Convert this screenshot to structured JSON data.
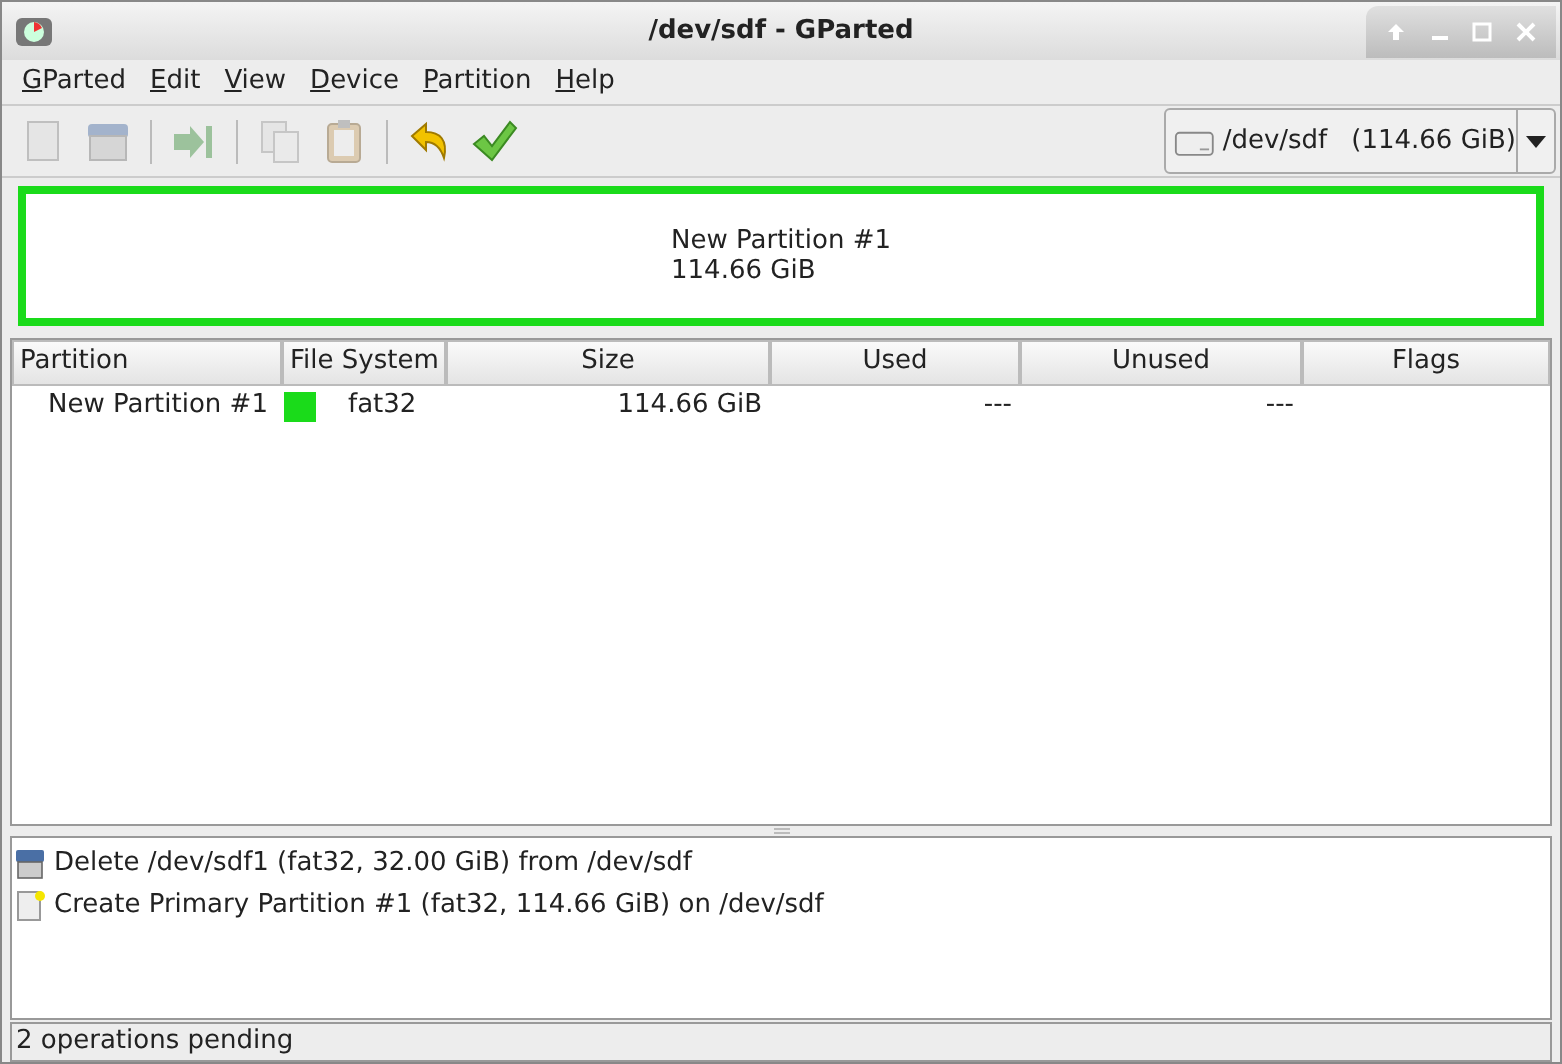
{
  "window": {
    "title": "/dev/sdf - GParted"
  },
  "menu": [
    "GParted",
    "Edit",
    "View",
    "Device",
    "Partition",
    "Help"
  ],
  "toolbar": [
    {
      "kind": "new",
      "disabled": true
    },
    {
      "kind": "delete",
      "disabled": true
    },
    {
      "kind": "sep"
    },
    {
      "kind": "resize",
      "disabled": true
    },
    {
      "kind": "sep"
    },
    {
      "kind": "copy",
      "disabled": true
    },
    {
      "kind": "paste",
      "disabled": true
    },
    {
      "kind": "sep"
    },
    {
      "kind": "undo",
      "disabled": false
    },
    {
      "kind": "apply",
      "disabled": false
    }
  ],
  "device": {
    "path": "/dev/sdf",
    "size": "(114.66 GiB)"
  },
  "map": {
    "name": "New Partition #1",
    "size": "114.66 GiB",
    "color": "#1adb1a"
  },
  "table": {
    "columns": [
      "Partition",
      "File System",
      "Size",
      "Used",
      "Unused",
      "Flags"
    ],
    "rows": [
      {
        "partition": "New Partition #1",
        "color": "#1adb1a",
        "file_system": "fat32",
        "size": "114.66 GiB",
        "used": "---",
        "unused": "---"
      }
    ]
  },
  "operations": [
    {
      "kind": "delete",
      "text": "Delete /dev/sdf1 (fat32, 32.00 GiB) from /dev/sdf"
    },
    {
      "kind": "create",
      "text": "Create Primary Partition #1 (fat32, 114.66 GiB) on /dev/sdf"
    }
  ],
  "status_bar": "2 operations pending"
}
